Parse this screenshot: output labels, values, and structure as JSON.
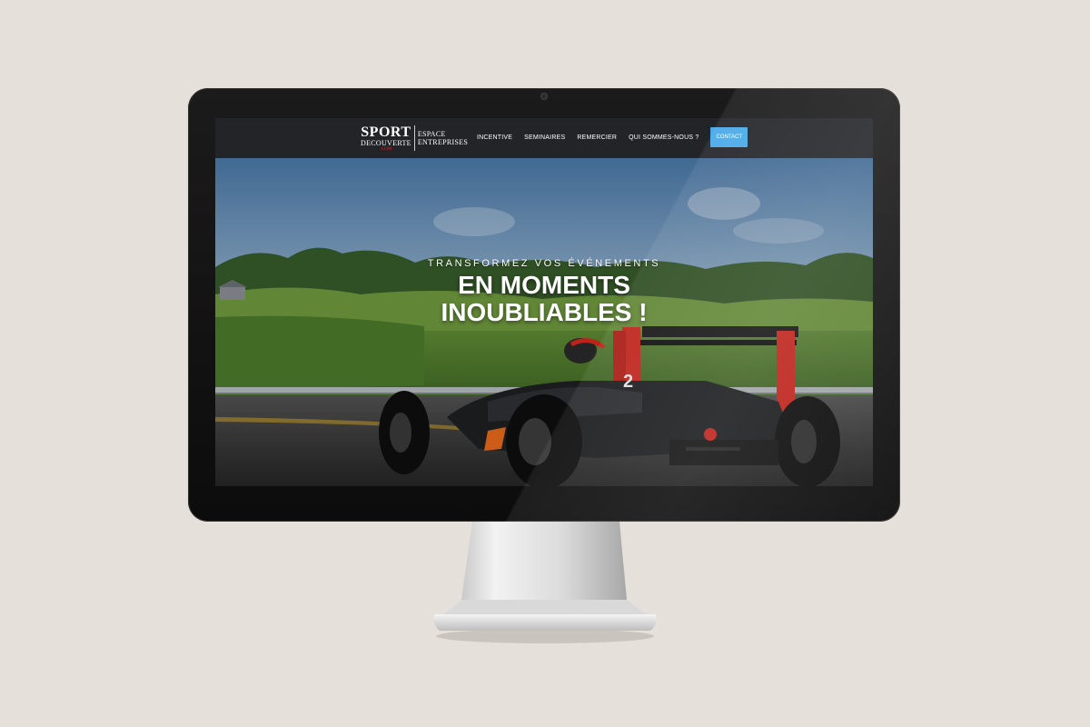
{
  "brand": {
    "sport": "SPORT",
    "decouverte": "DECOUVERTE",
    "com": ".COM",
    "espace": "ESPACE",
    "entreprises": "ENTREPRISES"
  },
  "nav": {
    "items": [
      {
        "label": "INCENTIVE"
      },
      {
        "label": "SEMINAIRES"
      },
      {
        "label": "REMERCIER"
      },
      {
        "label": "QUI SOMMES-NOUS ?"
      }
    ],
    "contact_label": "CONTACT"
  },
  "hero": {
    "kicker": "TRANSFORMEZ VOS ÉVÉNEMENTS",
    "title_line1": "EN MOMENTS",
    "title_line2": "INOUBLIABLES !",
    "car_number": "2"
  },
  "colors": {
    "background": "#e6e0da",
    "navbar": "#232428",
    "contact_button": "#4aa9e8",
    "brand_accent": "#d8262b",
    "car_accent": "#d9281f"
  }
}
